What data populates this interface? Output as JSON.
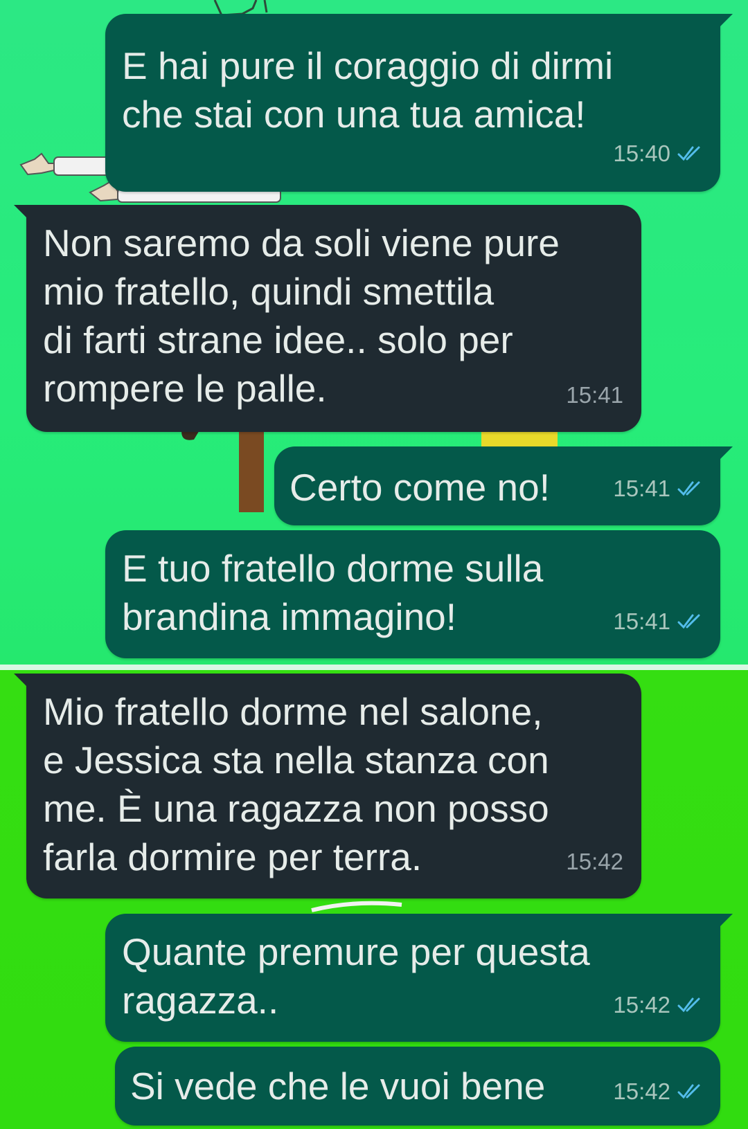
{
  "colors": {
    "outgoing_bubble": "#04594a",
    "incoming_bubble": "#1f2a31",
    "read_ticks": "#53bdeb",
    "wallpaper_top": "#27ec7a",
    "wallpaper_bottom": "#33dd10"
  },
  "messages": [
    {
      "direction": "outgoing",
      "text": "E hai pure il coraggio di dirmi\nche stai con una tua amica!",
      "time": "15:40",
      "status_icon": "double-check-read-icon"
    },
    {
      "direction": "incoming",
      "text": "Non saremo da soli viene pure\nmio fratello, quindi smettila\ndi farti strane idee.. solo per\nrompere le palle.",
      "time": "15:41"
    },
    {
      "direction": "outgoing",
      "text": "Certo come no!",
      "time": "15:41",
      "status_icon": "double-check-read-icon"
    },
    {
      "direction": "outgoing",
      "text": "E tuo fratello dorme sulla\nbrandina immagino!",
      "time": "15:41",
      "status_icon": "double-check-read-icon"
    },
    {
      "direction": "incoming",
      "text": "Mio fratello dorme nel salone,\ne Jessica sta nella stanza con\nme. È una ragazza non posso\nfarla dormire per terra.",
      "time": "15:42"
    },
    {
      "direction": "outgoing",
      "text": "Quante premure per questa\nragazza..",
      "time": "15:42",
      "status_icon": "double-check-read-icon"
    },
    {
      "direction": "outgoing",
      "text": "Si vede che le vuoi bene",
      "time": "15:42",
      "status_icon": "double-check-read-icon"
    }
  ]
}
